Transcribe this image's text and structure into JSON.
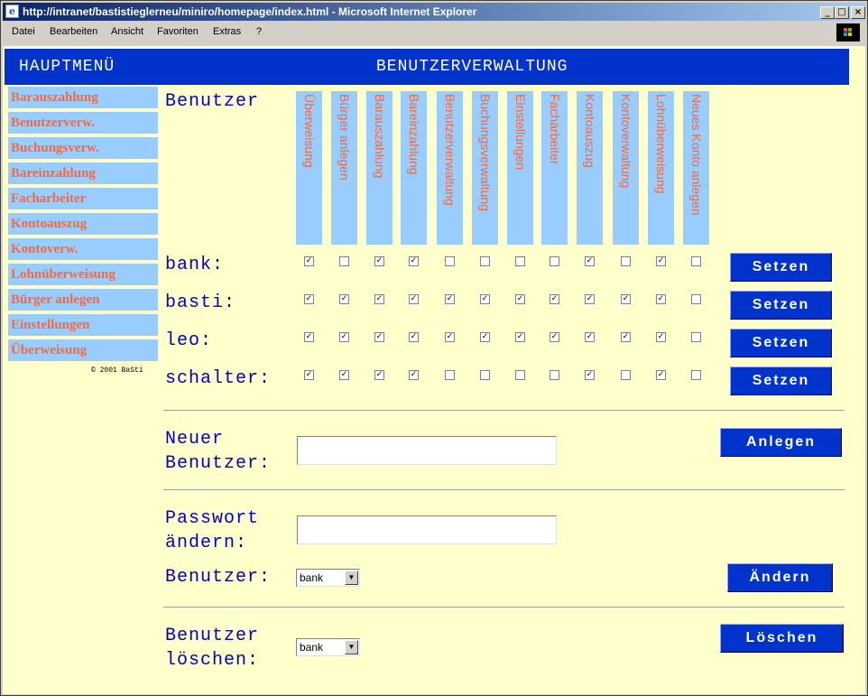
{
  "window": {
    "title": "http://intranet/bastistieglerneu/miniro/homepage/index.html - Microsoft Internet Explorer",
    "min": "_",
    "max": "□",
    "close": "×"
  },
  "menu": [
    "Datei",
    "Bearbeiten",
    "Ansicht",
    "Favoriten",
    "Extras",
    "?"
  ],
  "header": {
    "left": "HAUPTMENÜ",
    "right": "BENUTZERVERWALTUNG"
  },
  "sidebar": {
    "items": [
      "Barauszahlung",
      "Benutzerverw.",
      "Buchungsverw.",
      "Bareinzahlung",
      "Facharbeiter",
      "Kontoauszug",
      "Kontoverw.",
      "Lohnüberweisung",
      "Bürger anlegen",
      "Einstellungen",
      "Überweisung"
    ],
    "copyright": "© 2001 BaSti"
  },
  "permissions": {
    "header_label": "Benutzer",
    "columns": [
      "Überweisung",
      "Bürger anlegen",
      "Barauszahlung",
      "Bareinzahlung",
      "Benutzerverwaltung",
      "Buchungsverwaltung",
      "Einstellungen",
      "Facharbeiter",
      "Kontoauszug",
      "Kontoverwaltung",
      "Lohnüberweisung",
      "Neues Konto anlegen"
    ],
    "rows": [
      {
        "user": "bank:",
        "checks": [
          true,
          false,
          true,
          true,
          false,
          false,
          false,
          false,
          true,
          false,
          true,
          false
        ],
        "button": "Setzen"
      },
      {
        "user": "basti:",
        "checks": [
          true,
          true,
          true,
          true,
          true,
          true,
          true,
          true,
          true,
          true,
          true,
          false
        ],
        "button": "Setzen"
      },
      {
        "user": "leo:",
        "checks": [
          true,
          true,
          true,
          true,
          true,
          true,
          true,
          true,
          true,
          true,
          true,
          false
        ],
        "button": "Setzen"
      },
      {
        "user": "schalter:",
        "checks": [
          true,
          true,
          true,
          true,
          false,
          false,
          false,
          false,
          true,
          false,
          true,
          false
        ],
        "button": "Setzen"
      }
    ]
  },
  "new_user": {
    "label_1": "Neuer",
    "label_2": "Benutzer:",
    "value": "",
    "button": "Anlegen"
  },
  "change_password": {
    "label_1": "Passwort",
    "label_2": "ändern:",
    "value": "",
    "user_label": "Benutzer:",
    "selected_user": "bank",
    "button": "Ändern"
  },
  "delete_user": {
    "label_1": "Benutzer",
    "label_2": "löschen:",
    "selected_user": "bank",
    "button": "Löschen"
  }
}
